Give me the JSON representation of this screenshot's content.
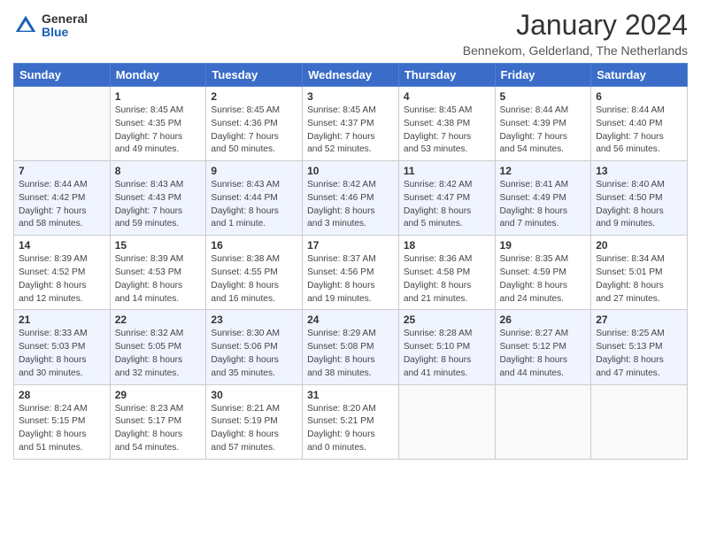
{
  "header": {
    "logo_general": "General",
    "logo_blue": "Blue",
    "title": "January 2024",
    "subtitle": "Bennekom, Gelderland, The Netherlands"
  },
  "days_of_week": [
    "Sunday",
    "Monday",
    "Tuesday",
    "Wednesday",
    "Thursday",
    "Friday",
    "Saturday"
  ],
  "weeks": [
    {
      "days": [
        {
          "num": "",
          "info": ""
        },
        {
          "num": "1",
          "info": "Sunrise: 8:45 AM\nSunset: 4:35 PM\nDaylight: 7 hours\nand 49 minutes."
        },
        {
          "num": "2",
          "info": "Sunrise: 8:45 AM\nSunset: 4:36 PM\nDaylight: 7 hours\nand 50 minutes."
        },
        {
          "num": "3",
          "info": "Sunrise: 8:45 AM\nSunset: 4:37 PM\nDaylight: 7 hours\nand 52 minutes."
        },
        {
          "num": "4",
          "info": "Sunrise: 8:45 AM\nSunset: 4:38 PM\nDaylight: 7 hours\nand 53 minutes."
        },
        {
          "num": "5",
          "info": "Sunrise: 8:44 AM\nSunset: 4:39 PM\nDaylight: 7 hours\nand 54 minutes."
        },
        {
          "num": "6",
          "info": "Sunrise: 8:44 AM\nSunset: 4:40 PM\nDaylight: 7 hours\nand 56 minutes."
        }
      ]
    },
    {
      "days": [
        {
          "num": "7",
          "info": "Sunrise: 8:44 AM\nSunset: 4:42 PM\nDaylight: 7 hours\nand 58 minutes."
        },
        {
          "num": "8",
          "info": "Sunrise: 8:43 AM\nSunset: 4:43 PM\nDaylight: 7 hours\nand 59 minutes."
        },
        {
          "num": "9",
          "info": "Sunrise: 8:43 AM\nSunset: 4:44 PM\nDaylight: 8 hours\nand 1 minute."
        },
        {
          "num": "10",
          "info": "Sunrise: 8:42 AM\nSunset: 4:46 PM\nDaylight: 8 hours\nand 3 minutes."
        },
        {
          "num": "11",
          "info": "Sunrise: 8:42 AM\nSunset: 4:47 PM\nDaylight: 8 hours\nand 5 minutes."
        },
        {
          "num": "12",
          "info": "Sunrise: 8:41 AM\nSunset: 4:49 PM\nDaylight: 8 hours\nand 7 minutes."
        },
        {
          "num": "13",
          "info": "Sunrise: 8:40 AM\nSunset: 4:50 PM\nDaylight: 8 hours\nand 9 minutes."
        }
      ]
    },
    {
      "days": [
        {
          "num": "14",
          "info": "Sunrise: 8:39 AM\nSunset: 4:52 PM\nDaylight: 8 hours\nand 12 minutes."
        },
        {
          "num": "15",
          "info": "Sunrise: 8:39 AM\nSunset: 4:53 PM\nDaylight: 8 hours\nand 14 minutes."
        },
        {
          "num": "16",
          "info": "Sunrise: 8:38 AM\nSunset: 4:55 PM\nDaylight: 8 hours\nand 16 minutes."
        },
        {
          "num": "17",
          "info": "Sunrise: 8:37 AM\nSunset: 4:56 PM\nDaylight: 8 hours\nand 19 minutes."
        },
        {
          "num": "18",
          "info": "Sunrise: 8:36 AM\nSunset: 4:58 PM\nDaylight: 8 hours\nand 21 minutes."
        },
        {
          "num": "19",
          "info": "Sunrise: 8:35 AM\nSunset: 4:59 PM\nDaylight: 8 hours\nand 24 minutes."
        },
        {
          "num": "20",
          "info": "Sunrise: 8:34 AM\nSunset: 5:01 PM\nDaylight: 8 hours\nand 27 minutes."
        }
      ]
    },
    {
      "days": [
        {
          "num": "21",
          "info": "Sunrise: 8:33 AM\nSunset: 5:03 PM\nDaylight: 8 hours\nand 30 minutes."
        },
        {
          "num": "22",
          "info": "Sunrise: 8:32 AM\nSunset: 5:05 PM\nDaylight: 8 hours\nand 32 minutes."
        },
        {
          "num": "23",
          "info": "Sunrise: 8:30 AM\nSunset: 5:06 PM\nDaylight: 8 hours\nand 35 minutes."
        },
        {
          "num": "24",
          "info": "Sunrise: 8:29 AM\nSunset: 5:08 PM\nDaylight: 8 hours\nand 38 minutes."
        },
        {
          "num": "25",
          "info": "Sunrise: 8:28 AM\nSunset: 5:10 PM\nDaylight: 8 hours\nand 41 minutes."
        },
        {
          "num": "26",
          "info": "Sunrise: 8:27 AM\nSunset: 5:12 PM\nDaylight: 8 hours\nand 44 minutes."
        },
        {
          "num": "27",
          "info": "Sunrise: 8:25 AM\nSunset: 5:13 PM\nDaylight: 8 hours\nand 47 minutes."
        }
      ]
    },
    {
      "days": [
        {
          "num": "28",
          "info": "Sunrise: 8:24 AM\nSunset: 5:15 PM\nDaylight: 8 hours\nand 51 minutes."
        },
        {
          "num": "29",
          "info": "Sunrise: 8:23 AM\nSunset: 5:17 PM\nDaylight: 8 hours\nand 54 minutes."
        },
        {
          "num": "30",
          "info": "Sunrise: 8:21 AM\nSunset: 5:19 PM\nDaylight: 8 hours\nand 57 minutes."
        },
        {
          "num": "31",
          "info": "Sunrise: 8:20 AM\nSunset: 5:21 PM\nDaylight: 9 hours\nand 0 minutes."
        },
        {
          "num": "",
          "info": ""
        },
        {
          "num": "",
          "info": ""
        },
        {
          "num": "",
          "info": ""
        }
      ]
    }
  ]
}
